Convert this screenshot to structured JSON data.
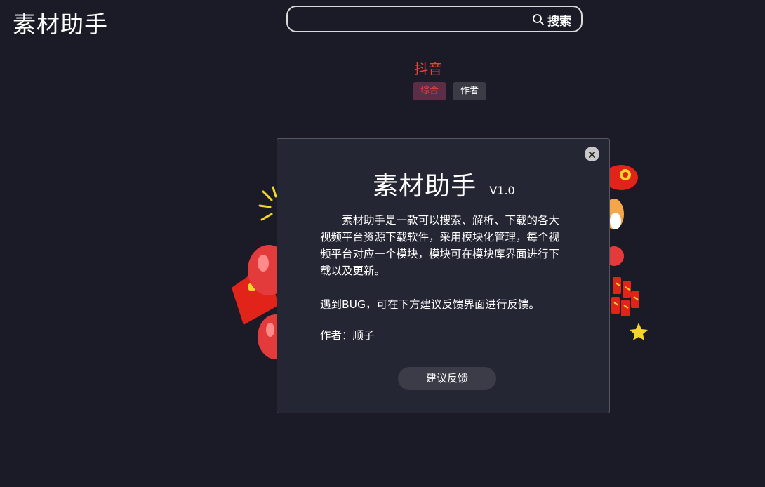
{
  "header": {
    "app_title": "素材助手",
    "search": {
      "placeholder": "",
      "value": "",
      "button_label": "搜索"
    }
  },
  "platform": {
    "name": "抖音",
    "tabs": [
      {
        "label": "综合",
        "active": true
      },
      {
        "label": "作者",
        "active": false
      }
    ]
  },
  "dialog": {
    "title": "素材助手",
    "version": "V1.0",
    "description": "素材助手是一款可以搜索、解析、下载的各大视频平台资源下载软件，采用模块化管理，每个视频平台对应一个模块，模块可在模块库界面进行下载以及更新。",
    "bug_note": "遇到BUG，可在下方建议反馈界面进行反馈。",
    "author": "作者：顺子",
    "feedback_button": "建议反馈",
    "close_icon": "close-icon"
  },
  "colors": {
    "background": "#1a1b26",
    "accent_red": "#e8433a",
    "tab_active_bg": "#5c2d46",
    "tab_normal_bg": "#3a3b45",
    "dialog_bg": "#252634"
  }
}
